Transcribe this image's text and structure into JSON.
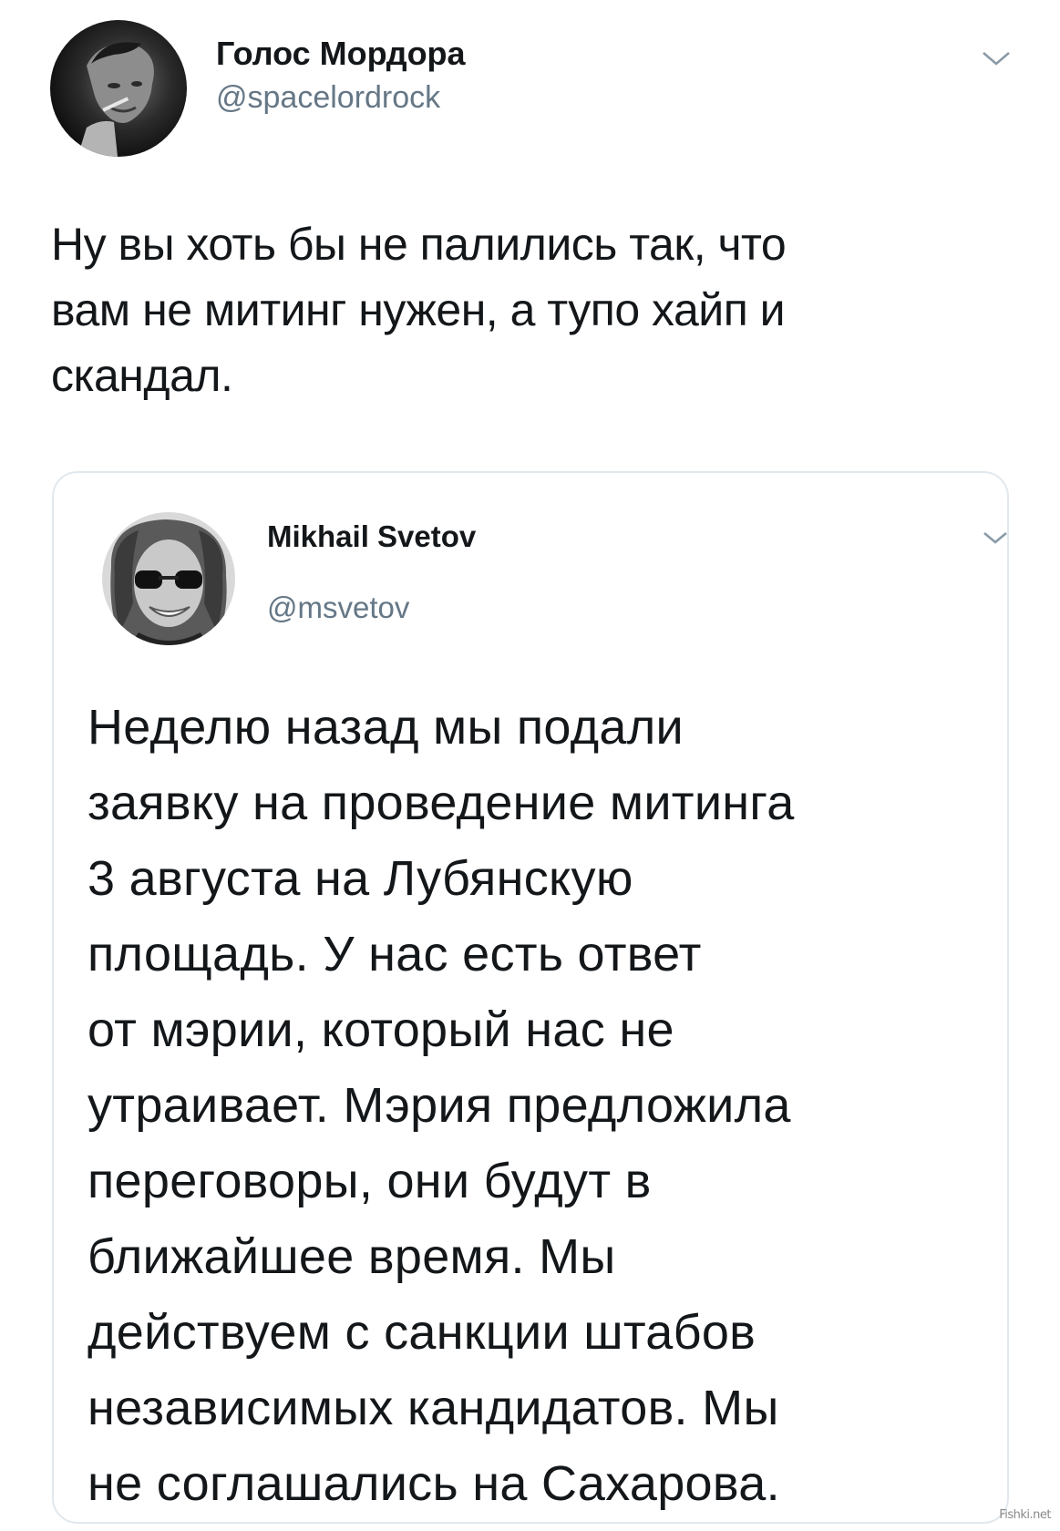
{
  "main_tweet": {
    "display_name": "Голос Мордора",
    "handle": "@spacelordrock",
    "text_lines": [
      "Ну вы хоть бы не палились так, что",
      "вам не митинг нужен, а тупо хайп и",
      "скандал."
    ],
    "menu_icon": "chevron-down-icon"
  },
  "quoted_tweet": {
    "display_name": "Mikhail Svetov",
    "handle": "@msvetov",
    "text_lines": [
      "Неделю назад мы подали",
      "заявку на проведение митинга",
      "3 августа на Лубянскую",
      "площадь. У нас есть ответ",
      "от мэрии, который нас не",
      "утраивает. Мэрия предложила",
      "переговоры, они будут в",
      "ближайшее время. Мы",
      "действуем с санкции штабов",
      "независимых кандидатов. Мы",
      "не соглашались на Сахарова."
    ],
    "menu_icon": "chevron-down-icon"
  },
  "watermark": "Fishki.net",
  "colors": {
    "text": "#14171a",
    "secondary_text": "#657786",
    "card_border": "#e1e8ed",
    "background": "#ffffff"
  }
}
